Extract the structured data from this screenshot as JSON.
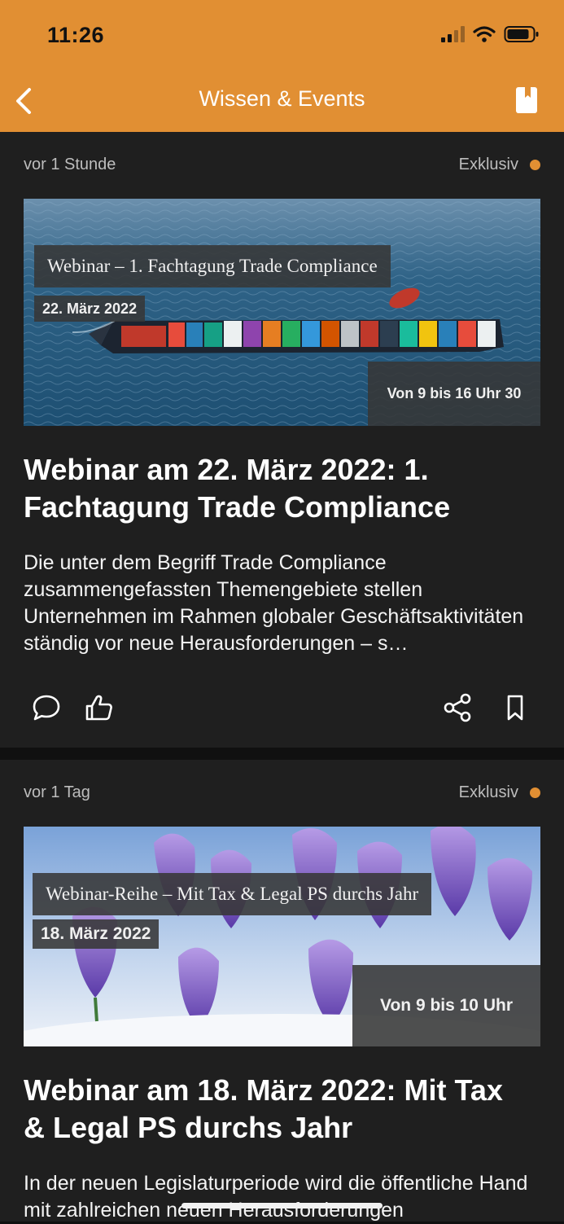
{
  "status_bar": {
    "time": "11:26"
  },
  "nav": {
    "title": "Wissen & Events"
  },
  "colors": {
    "accent": "#e18f33",
    "card_bg": "#1f1f1f",
    "page_bg": "#101010"
  },
  "articles": [
    {
      "age": "vor 1 Stunde",
      "badge": "Exklusiv",
      "image": {
        "title": "Webinar – 1. Fachtagung Trade Compliance",
        "date": "22. März 2022",
        "time": "Von 9 bis 16 Uhr 30",
        "subject": "container-ship-aerial"
      },
      "headline": "Webinar am 22. März 2022: 1. Fachtagung Trade Compliance",
      "summary": "Die unter dem Begriff Trade Compliance zusammengefassten Themengebiete stellen Unternehmen im Rahmen globaler Geschäftsaktivitäten ständig vor neue Herausforderungen – s…",
      "actions": [
        "comment-icon",
        "like-icon",
        "share-icon",
        "bookmark-icon"
      ]
    },
    {
      "age": "vor 1 Tag",
      "badge": "Exklusiv",
      "image": {
        "title": "Webinar-Reihe – Mit Tax & Legal PS durchs Jahr",
        "date": "18. März 2022",
        "time": "Von 9 bis 10 Uhr",
        "subject": "purple-crocus-flowers"
      },
      "headline": "Webinar am 18. März 2022: Mit Tax & Legal PS durchs Jahr",
      "summary": "In der neuen Legislaturperiode wird die öffentliche Hand mit zahlreichen neuen Herausforderungen"
    }
  ]
}
